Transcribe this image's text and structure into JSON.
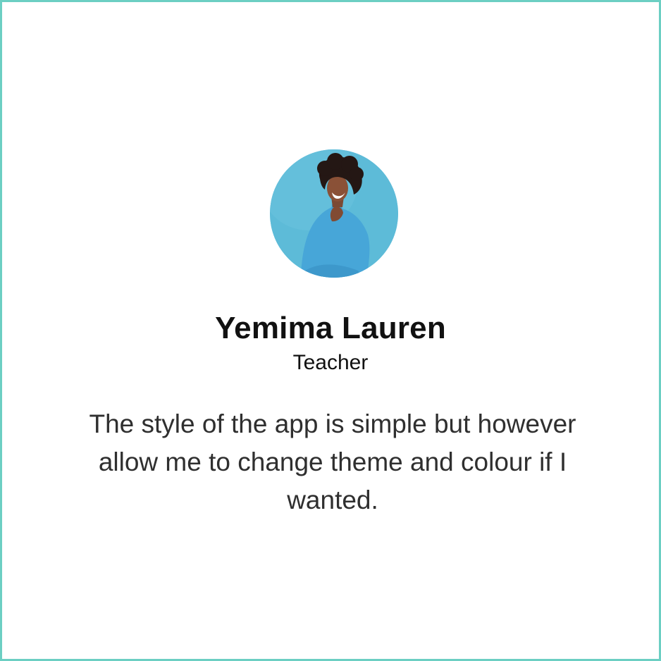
{
  "testimonial": {
    "name": "Yemima Lauren",
    "role": "Teacher",
    "quote": "The style of the app is simple but however allow me to change theme and colour if I wanted."
  },
  "theme": {
    "border_color": "#6ccfc3",
    "avatar_background": "#5dbbd8",
    "name_color": "#111111",
    "quote_color": "#2f2f2f"
  },
  "icons": {
    "avatar": "person-photo"
  }
}
